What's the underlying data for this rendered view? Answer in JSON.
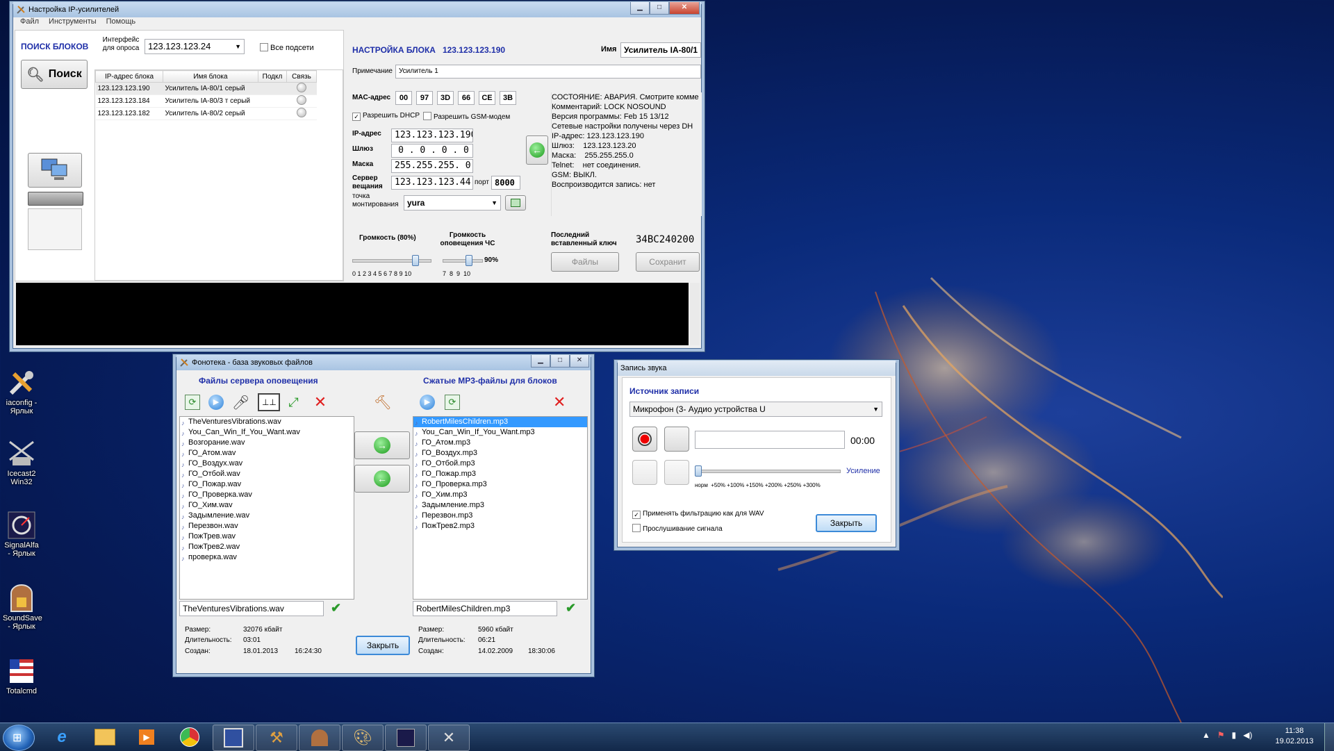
{
  "desktop": {
    "icons": [
      {
        "label": "iaconfig - Ярлык"
      },
      {
        "label": "Icecast2 Win32"
      },
      {
        "label": "SignalAlfa - Ярлык"
      },
      {
        "label": "SoundSave - Ярлык"
      },
      {
        "label": "Totalcmd"
      }
    ]
  },
  "main_window": {
    "title": "Настройка IP-усилителей",
    "menu": [
      "Файл",
      "Инструменты",
      "Помощь"
    ],
    "search": {
      "header": "ПОИСК БЛОКОВ",
      "iface_label": "Интерфейс для опроса",
      "iface_value": "123.123.123.24",
      "all_subnets": "Все подсети",
      "search_button": "Поиск",
      "columns": [
        "IP-адрес блока",
        "Имя блока",
        "Подкл",
        "Связь"
      ],
      "rows": [
        {
          "ip": "123.123.123.190",
          "name": "Усилитель IA-80/1 серый"
        },
        {
          "ip": "123.123.123.184",
          "name": "Усилитель IA-80/3 т серый"
        },
        {
          "ip": "123.123.123.182",
          "name": "Усилитель IA-80/2 серый"
        }
      ]
    },
    "block": {
      "header": "НАСТРОЙКА БЛОКА",
      "ip": "123.123.123.190",
      "name_label": "Имя",
      "name_value": "Усилитель IA-80/1",
      "note_label": "Примечание",
      "note_value": "Усилитель 1",
      "mac_label": "MAC-адрес",
      "mac": [
        "00",
        "97",
        "3D",
        "66",
        "CE",
        "3B"
      ],
      "dhcp_label": "Разрешить DHCP",
      "gsm_label": "Разрешить GSM-модем",
      "ip_label": "IP-адрес",
      "ip_value": "123.123.123.190",
      "gw_label": "Шлюз",
      "gw_value": "0 . 0 . 0 . 0",
      "mask_label": "Маска",
      "mask_value": "255.255.255. 0",
      "server_label": "Сервер вещания",
      "server_value": "123.123.123.44",
      "port_label": "порт",
      "port_value": "8000",
      "mount_label": "точка монтирования",
      "mount_value": "yura",
      "status_lines": [
        "СОСТОЯНИЕ: АВАРИЯ. Смотрите комме",
        "Комментарий: LOCK NOSOUND",
        "Версия программы: Feb 15 13/12",
        "Сетевые настройки получены через DH",
        "IP-адрес: 123.123.123.190",
        "Шлюз:    123.123.123.20",
        "Маска:    255.255.255.0",
        "Telnet:    нет соединения.",
        "GSM: ВЫКЛ.",
        "Воспроизводится запись: нет"
      ],
      "volume_label": "Громкость  (80%)",
      "volume_value": 0.8,
      "volume_ticks": "0 1 2 3 4 5 6 7 8 9 10",
      "alert_label": "Громкость оповещения ЧС",
      "alert_value": 0.9,
      "alert_pct": "90%",
      "alert_ticks": "7  8  9  10",
      "last_key_label": "Последний вставленный ключ",
      "last_key_value": "34BC240200",
      "files_button": "Файлы",
      "save_button": "Сохранит"
    }
  },
  "phonoteka": {
    "title": "Фонотека - база звуковых файлов",
    "left_header": "Файлы сервера оповещения",
    "right_header": "Сжатые MP3-файлы для блоков",
    "left_files": [
      "TheVenturesVibrations.wav",
      "You_Can_Win_If_You_Want.wav",
      "Возгорание.wav",
      "ГО_Атом.wav",
      "ГО_Воздух.wav",
      "ГО_Отбой.wav",
      "ГО_Пожар.wav",
      "ГО_Проверка.wav",
      "ГО_Хим.wav",
      "Задымление.wav",
      "Перезвон.wav",
      "ПожТрев.wav",
      "ПожТрев2.wav",
      "проверка.wav"
    ],
    "right_files": [
      "RobertMilesChildren.mp3",
      "You_Can_Win_If_You_Want.mp3",
      "ГО_Атом.mp3",
      "ГО_Воздух.mp3",
      "ГО_Отбой.mp3",
      "ГО_Пожар.mp3",
      "ГО_Проверка.mp3",
      "ГО_Хим.mp3",
      "Задымление.mp3",
      "Перезвон.mp3",
      "ПожТрев2.mp3"
    ],
    "left_selected_name": "TheVenturesVibrations.wav",
    "right_selected_name": "RobertMilesChildren.mp3",
    "size_label": "Размер:",
    "dur_label": "Длительность:",
    "created_label": "Создан:",
    "left_info": {
      "size": "32076 кбайт",
      "duration": "03:01",
      "date": "18.01.2013",
      "time": "16:24:30"
    },
    "right_info": {
      "size": "5960 кбайт",
      "duration": "06:21",
      "date": "14.02.2009",
      "time": "18:30:06"
    },
    "close_button": "Закрыть"
  },
  "recorder": {
    "title": "Запись звука",
    "source_header": "Источник записи",
    "source_value": "Микрофон (3- Аудио устройства U",
    "time": "00:00",
    "gain_label": "Усиление",
    "gain_ticks": "норм  +50% +100% +150% +200% +250% +300%",
    "filter_label": "Применять фильтрацию как для WAV",
    "listen_label": "Прослушивание сигнала",
    "close_button": "Закрыть"
  },
  "taskbar": {
    "time": "11:38",
    "date": "19.02.2013"
  }
}
